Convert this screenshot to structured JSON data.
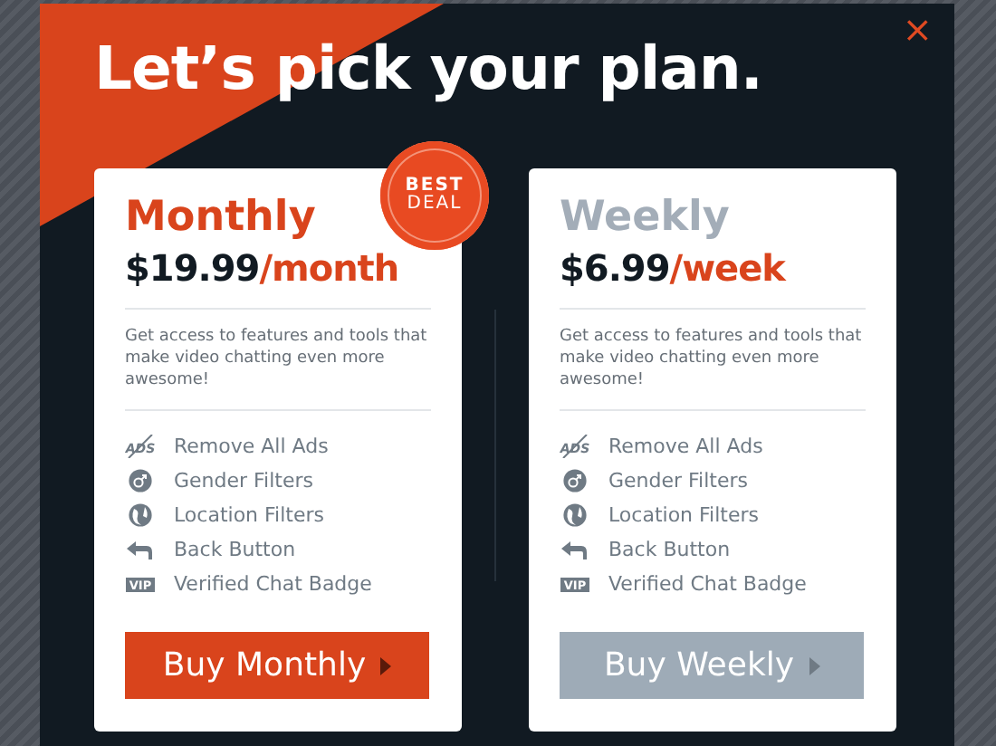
{
  "dialog": {
    "title": "Let’s pick your plan.",
    "close": "×"
  },
  "plans": [
    {
      "name": "Monthly",
      "featured": true,
      "badge": [
        "BEST",
        "DEAL"
      ],
      "price": "$19.99",
      "period": "/month",
      "description": "Get access to features and tools that make video chatting even more awesome!",
      "features": [
        {
          "kind": "ads",
          "icon_text": "ADS",
          "label": "Remove All Ads"
        },
        {
          "kind": "gender",
          "label": "Gender Filters"
        },
        {
          "kind": "globe",
          "label": "Location Filters"
        },
        {
          "kind": "back",
          "label": "Back Button"
        },
        {
          "kind": "vip",
          "icon_text": "VIP",
          "label": "Verified Chat Badge"
        }
      ],
      "button": "Buy Monthly"
    },
    {
      "name": "Weekly",
      "featured": false,
      "price": "$6.99",
      "period": "/week",
      "description": "Get access to features and tools that make video chatting even more awesome!",
      "features": [
        {
          "kind": "ads",
          "icon_text": "ADS",
          "label": "Remove All Ads"
        },
        {
          "kind": "gender",
          "label": "Gender Filters"
        },
        {
          "kind": "globe",
          "label": "Location Filters"
        },
        {
          "kind": "back",
          "label": "Back Button"
        },
        {
          "kind": "vip",
          "icon_text": "VIP",
          "label": "Verified Chat Badge"
        }
      ],
      "button": "Buy Weekly"
    }
  ]
}
